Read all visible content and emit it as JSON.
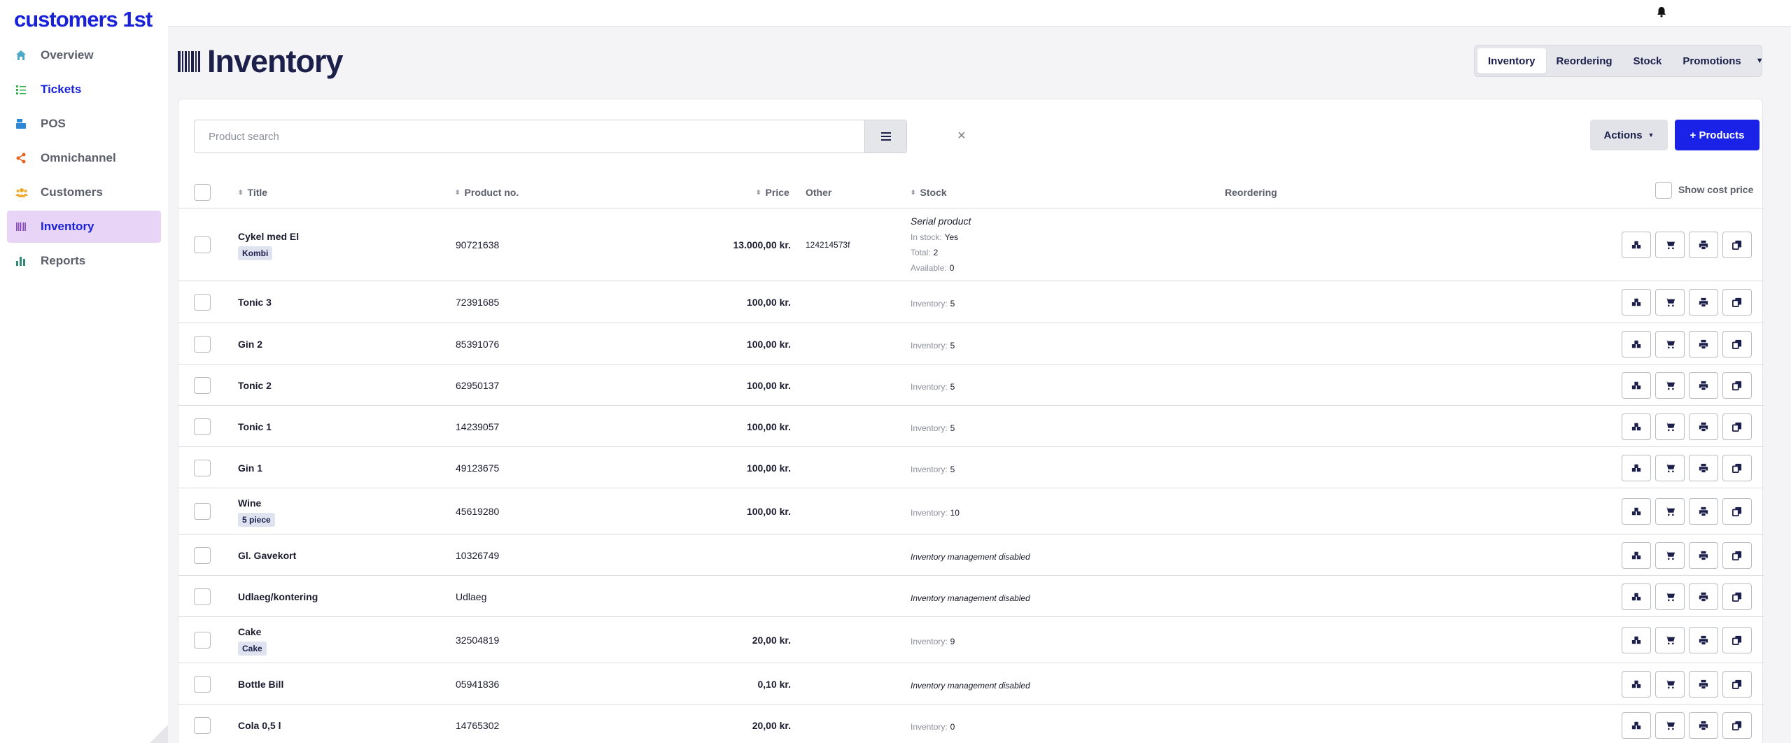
{
  "app": {
    "logo": "customers 1st"
  },
  "sidebar": {
    "items": [
      {
        "label": "Overview",
        "icon": "home-icon",
        "color": "#4aa9c9"
      },
      {
        "label": "Tickets",
        "icon": "list-check-icon",
        "color": "#2db34a"
      },
      {
        "label": "POS",
        "icon": "cash-register-icon",
        "color": "#2d88d6"
      },
      {
        "label": "Omnichannel",
        "icon": "share-icon",
        "color": "#e8621e"
      },
      {
        "label": "Customers",
        "icon": "users-icon",
        "color": "#f0a92d"
      },
      {
        "label": "Inventory",
        "icon": "barcode-icon",
        "color": "#8a4bc7"
      },
      {
        "label": "Reports",
        "icon": "bar-chart-icon",
        "color": "#2f8a7a"
      }
    ]
  },
  "header": {
    "title": "Inventory",
    "tabs": [
      "Inventory",
      "Reordering",
      "Stock",
      "Promotions"
    ]
  },
  "toolbar": {
    "search_placeholder": "Product search",
    "actions_label": "Actions",
    "products_label": "+ Products"
  },
  "table": {
    "columns": {
      "title": "Title",
      "product_no": "Product no.",
      "price": "Price",
      "other": "Other",
      "stock": "Stock",
      "reordering": "Reordering"
    },
    "show_cost_price_label": "Show cost price",
    "stock_labels": {
      "serial": "Serial product",
      "in_stock": "In stock:",
      "total": "Total:",
      "available": "Available:",
      "inventory": "Inventory:",
      "disabled": "Inventory management disabled"
    },
    "rows": [
      {
        "title": "Cykel med El",
        "tag": "Kombi",
        "product_no": "90721638",
        "price": "13.000,00 kr.",
        "other": "124214573f",
        "stock_type": "serial",
        "in_stock": "Yes",
        "total": "2",
        "available": "0"
      },
      {
        "title": "Tonic 3",
        "product_no": "72391685",
        "price": "100,00 kr.",
        "stock_type": "inventory",
        "inventory": "5"
      },
      {
        "title": "Gin 2",
        "product_no": "85391076",
        "price": "100,00 kr.",
        "stock_type": "inventory",
        "inventory": "5"
      },
      {
        "title": "Tonic 2",
        "product_no": "62950137",
        "price": "100,00 kr.",
        "stock_type": "inventory",
        "inventory": "5"
      },
      {
        "title": "Tonic 1",
        "product_no": "14239057",
        "price": "100,00 kr.",
        "stock_type": "inventory",
        "inventory": "5"
      },
      {
        "title": "Gin 1",
        "product_no": "49123675",
        "price": "100,00 kr.",
        "stock_type": "inventory",
        "inventory": "5"
      },
      {
        "title": "Wine",
        "tag": "5 piece",
        "product_no": "45619280",
        "price": "100,00 kr.",
        "stock_type": "inventory",
        "inventory": "10"
      },
      {
        "title": "Gl. Gavekort",
        "product_no": "10326749",
        "price": "",
        "stock_type": "disabled"
      },
      {
        "title": "Udlaeg/kontering",
        "product_no": "Udlaeg",
        "price": "",
        "stock_type": "disabled"
      },
      {
        "title": "Cake",
        "tag": "Cake",
        "product_no": "32504819",
        "price": "20,00 kr.",
        "stock_type": "inventory",
        "inventory": "9"
      },
      {
        "title": "Bottle Bill",
        "product_no": "05941836",
        "price": "0,10 kr.",
        "stock_type": "disabled"
      },
      {
        "title": "Cola 0,5 l",
        "product_no": "14765302",
        "price": "20,00 kr.",
        "stock_type": "inventory",
        "inventory": "0"
      }
    ],
    "row_actions": [
      "stock-boxes-icon",
      "cart-icon",
      "print-icon",
      "copy-icon"
    ]
  }
}
